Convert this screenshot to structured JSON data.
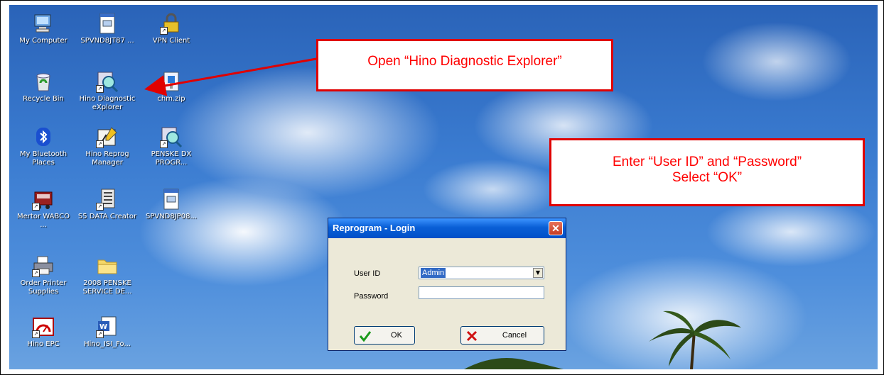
{
  "desktop": {
    "icons": [
      {
        "label": "My Computer",
        "icon": "computer-icon"
      },
      {
        "label": "SPVND8JT87 ...",
        "icon": "document-icon"
      },
      {
        "label": "VPN Client",
        "icon": "lock-icon"
      },
      {
        "label": "Recycle Bin",
        "icon": "recycle-bin-icon"
      },
      {
        "label": "Hino Diagnostic eXplorer",
        "icon": "magnifier-icon"
      },
      {
        "label": "chm.zip",
        "icon": "zip-icon"
      },
      {
        "label": "My Bluetooth Places",
        "icon": "bluetooth-icon"
      },
      {
        "label": "Hino Reprog Manager",
        "icon": "reprog-icon"
      },
      {
        "label": "PENSKE DX PROGR...",
        "icon": "magnifier-icon"
      },
      {
        "label": "Mertor WABCO ...",
        "icon": "truck-icon"
      },
      {
        "label": "S5 DATA Creator",
        "icon": "data-icon"
      },
      {
        "label": "SPVND8JP08...",
        "icon": "document-icon"
      },
      {
        "label": "Order Printer Supplies",
        "icon": "printer-icon"
      },
      {
        "label": "2008 PENSKE SERVICE DE...",
        "icon": "folder-icon"
      },
      {
        "label": "Hino EPC",
        "icon": "gauge-icon"
      },
      {
        "label": "Hino_ISI_Fo...",
        "icon": "word-doc-icon"
      }
    ]
  },
  "callouts": {
    "open_app": "Open “Hino Diagnostic Explorer”",
    "enter_credentials_line1": "Enter “User ID” and “Password”",
    "enter_credentials_line2": "Select “OK”"
  },
  "dialog": {
    "title": "Reprogram - Login",
    "close_glyph": "✕",
    "userid_label": "User ID",
    "userid_value": "Admin",
    "password_label": "Password",
    "password_value": "",
    "ok_label": "OK",
    "cancel_label": "Cancel"
  },
  "colors": {
    "callout_border": "#e00000",
    "callout_text": "#ff0000",
    "titlebar": "#0a5fd6"
  }
}
